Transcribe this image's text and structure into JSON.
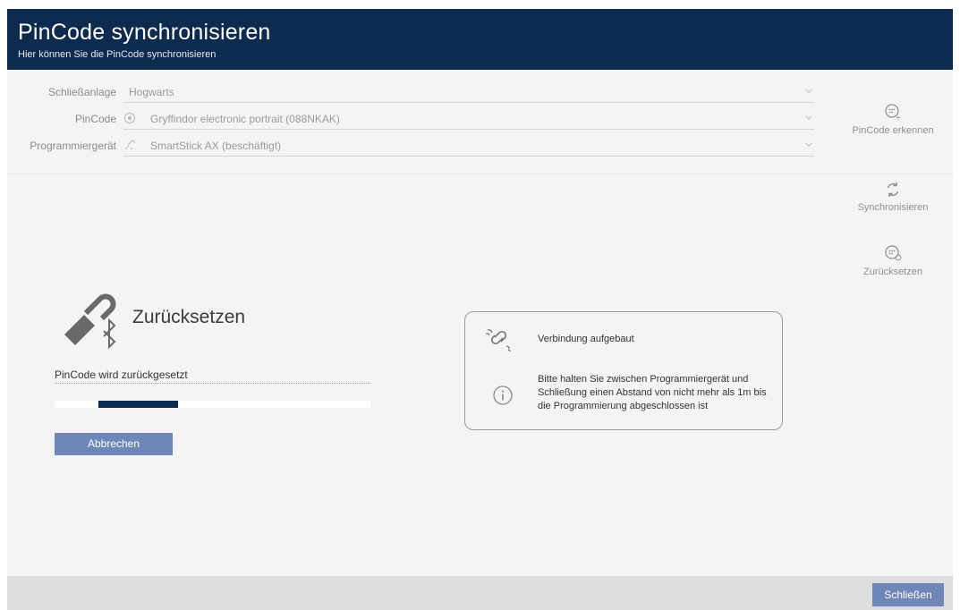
{
  "header": {
    "title": "PinCode synchronisieren",
    "subtitle": "Hier können Sie die PinCode synchronisieren"
  },
  "form": {
    "locking_system": {
      "label": "Schließanlage",
      "value": "Hogwarts"
    },
    "pincode": {
      "label": "PinCode",
      "value": "Gryffindor electronic portrait (088NKAK)"
    },
    "programmer": {
      "label": "Programmiergerät",
      "value": "SmartStick AX (beschäftigt)"
    }
  },
  "side_actions": {
    "detect": "PinCode erkennen",
    "sync": "Synchronisieren",
    "reset": "Zurücksetzen"
  },
  "progress": {
    "title": "Zurücksetzen",
    "status": "PinCode wird zurückgesetzt",
    "cancel_label": "Abbrechen"
  },
  "info": {
    "connection": "Verbindung aufgebaut",
    "hint": "Bitte halten Sie zwischen Programmiergerät und Schließung einen Abstand von nicht mehr als 1m bis die Programmierung abgeschlossen ist"
  },
  "footer": {
    "close_label": "Schließen"
  },
  "colors": {
    "header": "#0d2a4f",
    "button": "#6f86b8",
    "progress_fill": "#0d2a4f"
  }
}
